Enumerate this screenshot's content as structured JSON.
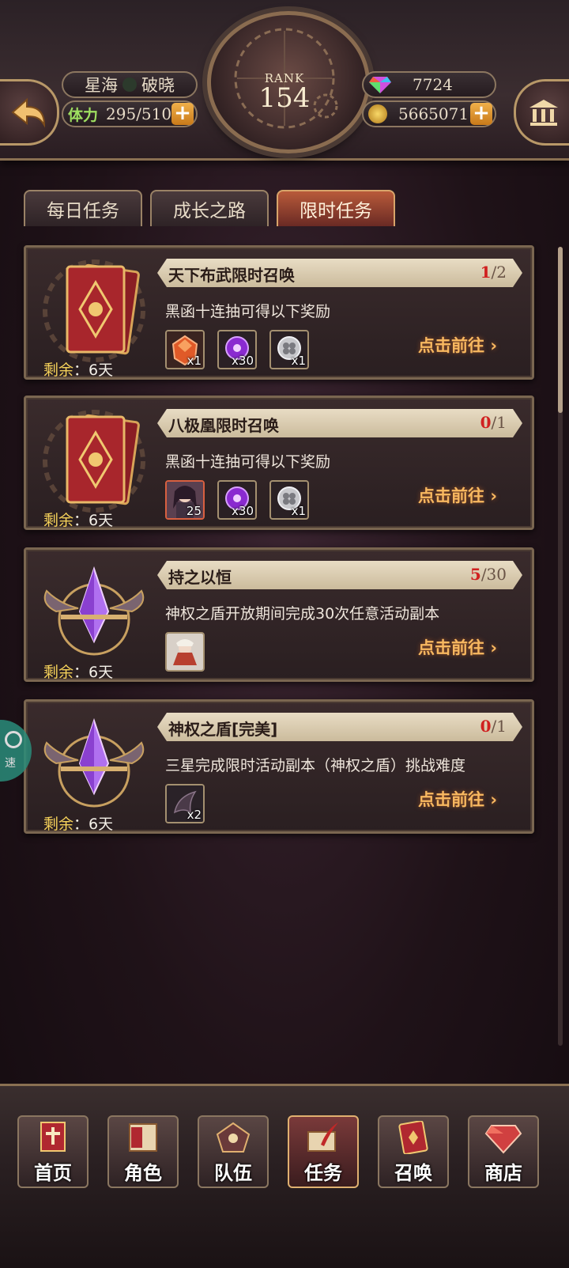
{
  "header": {
    "player_name": "星海",
    "player_suffix": "破晓",
    "stamina_label": "体力",
    "stamina_value": "295/510",
    "rank_label": "RANK",
    "rank_value": "154",
    "gems": "7724",
    "gold": "5665071"
  },
  "tabs": [
    {
      "label": "每日任务",
      "active": false
    },
    {
      "label": "成长之路",
      "active": false
    },
    {
      "label": "限时任务",
      "active": true
    }
  ],
  "tasks": [
    {
      "title": "天下布武限时召唤",
      "progress_current": "1",
      "progress_total": "/2",
      "desc": "黑函十连抽可得以下奖励",
      "remain_key": "剩余",
      "remain_value": "：6天",
      "go_label": "点击前往",
      "icon": "red-card-icon",
      "rewards": [
        {
          "icon": "orange-crystal-icon",
          "qty": "x1"
        },
        {
          "icon": "purple-orb-icon",
          "qty": "x30"
        },
        {
          "icon": "silver-clover-coin-icon",
          "qty": "x1"
        }
      ]
    },
    {
      "title": "八极凰限时召唤",
      "progress_current": "0",
      "progress_total": "/1",
      "desc": "黑函十连抽可得以下奖励",
      "remain_key": "剩余",
      "remain_value": "：6天",
      "go_label": "点击前往",
      "icon": "red-card-icon",
      "rewards": [
        {
          "icon": "character-portrait-icon",
          "qty": "25"
        },
        {
          "icon": "purple-orb-icon",
          "qty": "x30"
        },
        {
          "icon": "silver-clover-coin-icon",
          "qty": "x1"
        }
      ]
    },
    {
      "title": "持之以恒",
      "progress_current": "5",
      "progress_total": "/30",
      "desc": "神权之盾开放期间完成30次任意活动副本",
      "remain_key": "剩余",
      "remain_value": "：6天",
      "go_label": "点击前往",
      "icon": "winged-crystal-icon",
      "rewards": [
        {
          "icon": "character-portrait-icon",
          "qty": ""
        }
      ]
    },
    {
      "title": "神权之盾[完美]",
      "progress_current": "0",
      "progress_total": "/1",
      "desc": "三星完成限时活动副本（神权之盾）挑战难度",
      "remain_key": "剩余",
      "remain_value": "：6天",
      "go_label": "点击前往",
      "icon": "winged-crystal-icon",
      "rewards": [
        {
          "icon": "dark-wing-icon",
          "qty": "x2"
        }
      ]
    }
  ],
  "speed_label": "速",
  "bottom_nav": [
    {
      "label": "首页",
      "icon": "home-banner-icon",
      "active": false
    },
    {
      "label": "角色",
      "icon": "character-book-icon",
      "active": false
    },
    {
      "label": "队伍",
      "icon": "team-pentagon-icon",
      "active": false
    },
    {
      "label": "任务",
      "icon": "quest-quill-icon",
      "active": true
    },
    {
      "label": "召唤",
      "icon": "summon-card-icon",
      "active": false
    },
    {
      "label": "商店",
      "icon": "shop-gem-icon",
      "active": false
    }
  ],
  "colors": {
    "accent": "#f8b860",
    "progress_current": "#d02020",
    "title_bar": "#e8dcc4",
    "frame": "#7a6650"
  }
}
